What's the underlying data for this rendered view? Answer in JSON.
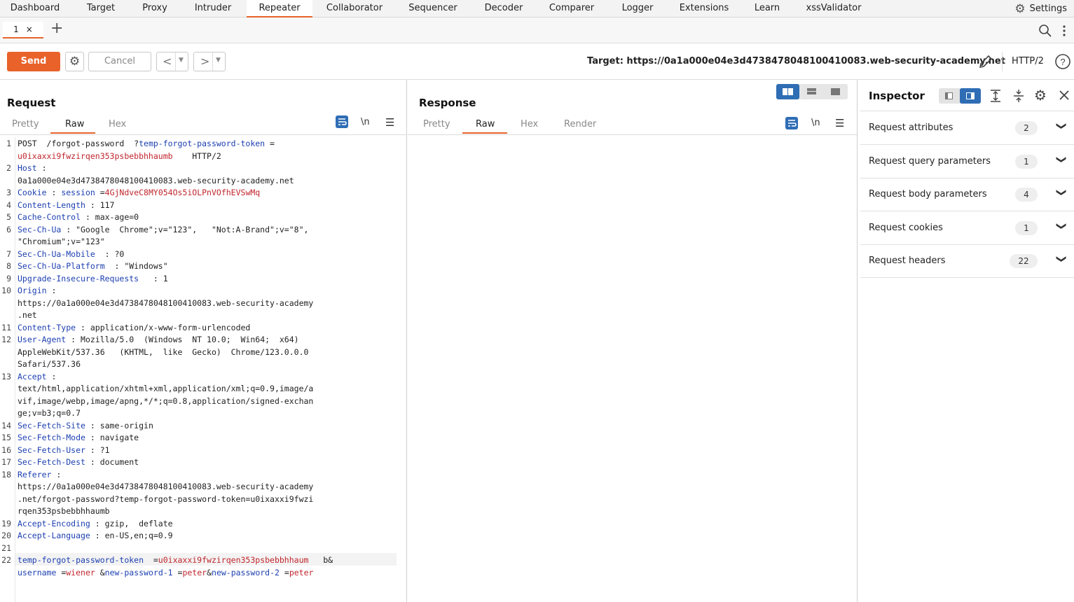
{
  "nav": {
    "tabs": [
      "Dashboard",
      "Target",
      "Proxy",
      "Intruder",
      "Repeater",
      "Collaborator",
      "Sequencer",
      "Decoder",
      "Comparer",
      "Logger",
      "Extensions",
      "Learn",
      "xssValidator"
    ],
    "active": "Repeater",
    "settings_label": "Settings"
  },
  "repeater_tabs": {
    "tab1_label": "1",
    "close": "×",
    "add": "+"
  },
  "toolbar": {
    "send_label": "Send",
    "cancel_label": "Cancel",
    "target_label": "Target: https://0a1a000e04e3d4738478048100410083.web-security-academy.net",
    "http_version": "HTTP/2"
  },
  "request": {
    "title": "Request",
    "subtabs": [
      "Pretty",
      "Raw",
      "Hex"
    ],
    "active_subtab": "Raw",
    "lines": [
      {
        "n": "1",
        "segs": [
          [
            "",
            "POST  /forgot-password  ?"
          ],
          [
            "k",
            "temp-forgot-password-token"
          ],
          [
            "",
            " =  "
          ]
        ]
      },
      {
        "n": "",
        "segs": [
          [
            "v",
            "u0ixaxxi9fwzirqen353psbebbhhaumb"
          ],
          [
            "",
            "    HTTP/2"
          ]
        ]
      },
      {
        "n": "2",
        "segs": [
          [
            "k",
            "Host"
          ],
          [
            "",
            " :"
          ]
        ]
      },
      {
        "n": "",
        "segs": [
          [
            "",
            "0a1a000e04e3d4738478048100410083.web-security-academy.net"
          ]
        ]
      },
      {
        "n": "3",
        "segs": [
          [
            "k",
            "Cookie"
          ],
          [
            "",
            " : "
          ],
          [
            "k",
            "session"
          ],
          [
            "",
            " ="
          ],
          [
            "v",
            "4GjNdveC8MY054Os5iOLPnVOfhEVSwMq"
          ]
        ]
      },
      {
        "n": "4",
        "segs": [
          [
            "k",
            "Content-Length"
          ],
          [
            "",
            " : 117"
          ]
        ]
      },
      {
        "n": "5",
        "segs": [
          [
            "k",
            "Cache-Control"
          ],
          [
            "",
            " : max-age=0"
          ]
        ]
      },
      {
        "n": "6",
        "segs": [
          [
            "k",
            "Sec-Ch-Ua"
          ],
          [
            "",
            " : \"Google  Chrome\";v=\"123\",   \"Not:A-Brand\";v=\"8\","
          ]
        ]
      },
      {
        "n": "",
        "segs": [
          [
            "",
            "\"Chromium\";v=\"123\""
          ]
        ]
      },
      {
        "n": "7",
        "segs": [
          [
            "k",
            "Sec-Ch-Ua-Mobile"
          ],
          [
            "",
            "  : ?0"
          ]
        ]
      },
      {
        "n": "8",
        "segs": [
          [
            "k",
            "Sec-Ch-Ua-Platform"
          ],
          [
            "",
            "  : \"Windows\""
          ]
        ]
      },
      {
        "n": "9",
        "segs": [
          [
            "k",
            "Upgrade-Insecure-Requests"
          ],
          [
            "",
            "   : 1"
          ]
        ]
      },
      {
        "n": "10",
        "segs": [
          [
            "k",
            "Origin"
          ],
          [
            "",
            " :"
          ]
        ]
      },
      {
        "n": "",
        "segs": [
          [
            "",
            "https://0a1a000e04e3d4738478048100410083.web-security-academy"
          ]
        ]
      },
      {
        "n": "",
        "segs": [
          [
            "",
            ".net"
          ]
        ]
      },
      {
        "n": "11",
        "segs": [
          [
            "k",
            "Content-Type"
          ],
          [
            "",
            " : application/x-www-form-urlencoded"
          ]
        ]
      },
      {
        "n": "12",
        "segs": [
          [
            "k",
            "User-Agent"
          ],
          [
            "",
            " : Mozilla/5.0  (Windows  NT 10.0;  Win64;  x64)"
          ]
        ]
      },
      {
        "n": "",
        "segs": [
          [
            "",
            "AppleWebKit/537.36   (KHTML,  like  Gecko)  Chrome/123.0.0.0"
          ]
        ]
      },
      {
        "n": "",
        "segs": [
          [
            "",
            "Safari/537.36"
          ]
        ]
      },
      {
        "n": "13",
        "segs": [
          [
            "k",
            "Accept"
          ],
          [
            "",
            " :"
          ]
        ]
      },
      {
        "n": "",
        "segs": [
          [
            "",
            "text/html,application/xhtml+xml,application/xml;q=0.9,image/a"
          ]
        ]
      },
      {
        "n": "",
        "segs": [
          [
            "",
            "vif,image/webp,image/apng,*/*;q=0.8,application/signed-exchan"
          ]
        ]
      },
      {
        "n": "",
        "segs": [
          [
            "",
            "ge;v=b3;q=0.7"
          ]
        ]
      },
      {
        "n": "14",
        "segs": [
          [
            "k",
            "Sec-Fetch-Site"
          ],
          [
            "",
            " : same-origin"
          ]
        ]
      },
      {
        "n": "15",
        "segs": [
          [
            "k",
            "Sec-Fetch-Mode"
          ],
          [
            "",
            " : navigate"
          ]
        ]
      },
      {
        "n": "16",
        "segs": [
          [
            "k",
            "Sec-Fetch-User"
          ],
          [
            "",
            " : ?1"
          ]
        ]
      },
      {
        "n": "17",
        "segs": [
          [
            "k",
            "Sec-Fetch-Dest"
          ],
          [
            "",
            " : document"
          ]
        ]
      },
      {
        "n": "18",
        "segs": [
          [
            "k",
            "Referer"
          ],
          [
            "",
            " :"
          ]
        ]
      },
      {
        "n": "",
        "segs": [
          [
            "",
            "https://0a1a000e04e3d4738478048100410083.web-security-academy"
          ]
        ]
      },
      {
        "n": "",
        "segs": [
          [
            "",
            ".net/forgot-password?temp-forgot-password-token=u0ixaxxi9fwzi"
          ]
        ]
      },
      {
        "n": "",
        "segs": [
          [
            "",
            "rqen353psbebbhhaumb"
          ]
        ]
      },
      {
        "n": "19",
        "segs": [
          [
            "k",
            "Accept-Encoding"
          ],
          [
            "",
            " : gzip,  deflate"
          ]
        ]
      },
      {
        "n": "20",
        "segs": [
          [
            "k",
            "Accept-Language"
          ],
          [
            "",
            " : en-US,en;q=0.9"
          ]
        ]
      },
      {
        "n": "21",
        "segs": [
          [
            "",
            ""
          ]
        ]
      },
      {
        "n": "22",
        "segs": [
          [
            "k",
            "temp-forgot-password-token"
          ],
          [
            "",
            "  ="
          ],
          [
            "v",
            "u0ixaxxi9fwzirqen353psbebbhhaum"
          ],
          [
            "",
            "   b&"
          ]
        ]
      },
      {
        "n": "",
        "segs": [
          [
            "k",
            "username"
          ],
          [
            "",
            " ="
          ],
          [
            "v",
            "wiener"
          ],
          [
            "",
            " &"
          ],
          [
            "k",
            "new-password-1"
          ],
          [
            "",
            " ="
          ],
          [
            "v",
            "peter"
          ],
          [
            "",
            "&"
          ],
          [
            "k",
            "new-password-2"
          ],
          [
            "",
            " ="
          ],
          [
            "v",
            "peter"
          ]
        ]
      }
    ]
  },
  "response": {
    "title": "Response",
    "subtabs": [
      "Pretty",
      "Raw",
      "Hex",
      "Render"
    ],
    "active_subtab": "Raw"
  },
  "inspector": {
    "title": "Inspector",
    "sections": [
      {
        "label": "Request attributes",
        "count": "2"
      },
      {
        "label": "Request query parameters",
        "count": "1"
      },
      {
        "label": "Request body parameters",
        "count": "4"
      },
      {
        "label": "Request cookies",
        "count": "1"
      },
      {
        "label": "Request headers",
        "count": "22"
      }
    ]
  },
  "icons": [
    "settings-gear-icon",
    "search-icon",
    "more-icon",
    "close-icon",
    "plus-icon",
    "pencil-icon",
    "help-icon",
    "wrap-icon",
    "newline-icon",
    "menu-icon",
    "chevron-down-icon",
    "expand-icon",
    "collapse-icon"
  ],
  "colors": {
    "accent": "#e8622a",
    "key": "#1c3fb0",
    "value": "#c0262d",
    "layout_active": "#2f6db5"
  }
}
